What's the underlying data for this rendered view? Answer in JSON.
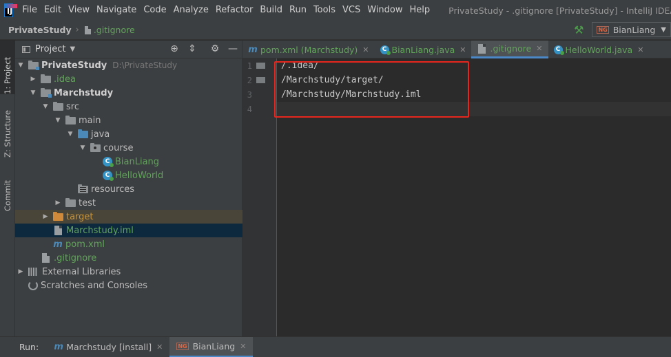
{
  "menu": {
    "items": [
      "File",
      "Edit",
      "View",
      "Navigate",
      "Code",
      "Analyze",
      "Refactor",
      "Build",
      "Run",
      "Tools",
      "VCS",
      "Window",
      "Help"
    ],
    "window_title": "PrivateStudy - .gitignore [PrivateStudy] - IntelliJ IDEA - Adr"
  },
  "navbar": {
    "project": "PrivateStudy",
    "file": ".gitignore",
    "run_config": "BianLiang"
  },
  "left_strip": {
    "project": "1: Project",
    "structure": "Z: Structure",
    "commit": "Commit"
  },
  "project_panel": {
    "title": "Project",
    "tree": [
      {
        "label": "PrivateStudy",
        "path": "D:\\PrivateStudy",
        "depth": 0,
        "expanded": true,
        "icon": "module-folder",
        "style": "bold"
      },
      {
        "label": ".idea",
        "depth": 1,
        "expanded": false,
        "icon": "folder",
        "style": "green"
      },
      {
        "label": "Marchstudy",
        "depth": 1,
        "expanded": true,
        "icon": "module-folder",
        "style": "bold"
      },
      {
        "label": "src",
        "depth": 2,
        "expanded": true,
        "icon": "folder",
        "style": "default"
      },
      {
        "label": "main",
        "depth": 3,
        "expanded": true,
        "icon": "folder",
        "style": "default"
      },
      {
        "label": "java",
        "depth": 4,
        "expanded": true,
        "icon": "source-folder",
        "style": "default"
      },
      {
        "label": "course",
        "depth": 5,
        "expanded": true,
        "icon": "package-folder",
        "style": "default"
      },
      {
        "label": "BianLiang",
        "depth": 6,
        "icon": "class",
        "style": "green"
      },
      {
        "label": "HelloWorld",
        "depth": 6,
        "icon": "class",
        "style": "green"
      },
      {
        "label": "resources",
        "depth": 4,
        "icon": "resources-folder",
        "style": "default"
      },
      {
        "label": "test",
        "depth": 3,
        "expanded": false,
        "icon": "folder",
        "style": "default"
      },
      {
        "label": "target",
        "depth": 2,
        "expanded": false,
        "icon": "excluded-folder",
        "style": "orange",
        "row": "brown"
      },
      {
        "label": "Marchstudy.iml",
        "depth": 2,
        "icon": "file",
        "style": "green",
        "row": "dark"
      },
      {
        "label": "pom.xml",
        "depth": 2,
        "icon": "maven",
        "style": "green"
      },
      {
        "label": ".gitignore",
        "depth": 1,
        "icon": "file",
        "style": "green"
      },
      {
        "label": "External Libraries",
        "depth": 0,
        "expanded": false,
        "icon": "library",
        "style": "default"
      },
      {
        "label": "Scratches and Consoles",
        "depth": 0,
        "icon": "scratch",
        "style": "default"
      }
    ]
  },
  "editor_tabs": [
    {
      "label": "pom.xml (Marchstudy)",
      "icon": "maven",
      "active": false
    },
    {
      "label": "BianLiang.java",
      "icon": "class",
      "active": false
    },
    {
      "label": ".gitignore",
      "icon": "file",
      "active": true
    },
    {
      "label": "HelloWorld.java",
      "icon": "class",
      "active": false
    }
  ],
  "editor": {
    "lines": [
      "/.idea/",
      "/Marchstudy/target/",
      "/Marchstudy/Marchstudy.iml",
      ""
    ],
    "line_numbers": [
      "1",
      "2",
      "3",
      "4"
    ],
    "current_line": 4,
    "highlight_color": "#e8261d"
  },
  "runbar": {
    "label": "Run:",
    "tabs": [
      {
        "label": "Marchstudy [install]",
        "icon": "maven",
        "active": false
      },
      {
        "label": "BianLiang",
        "icon": "testng",
        "active": true
      }
    ]
  },
  "colors": {
    "accent": "#4a88c7",
    "vcs_added": "#62a35c",
    "excluded": "#c6943e",
    "background": "#2b2b2b",
    "panel": "#3c3f41"
  }
}
